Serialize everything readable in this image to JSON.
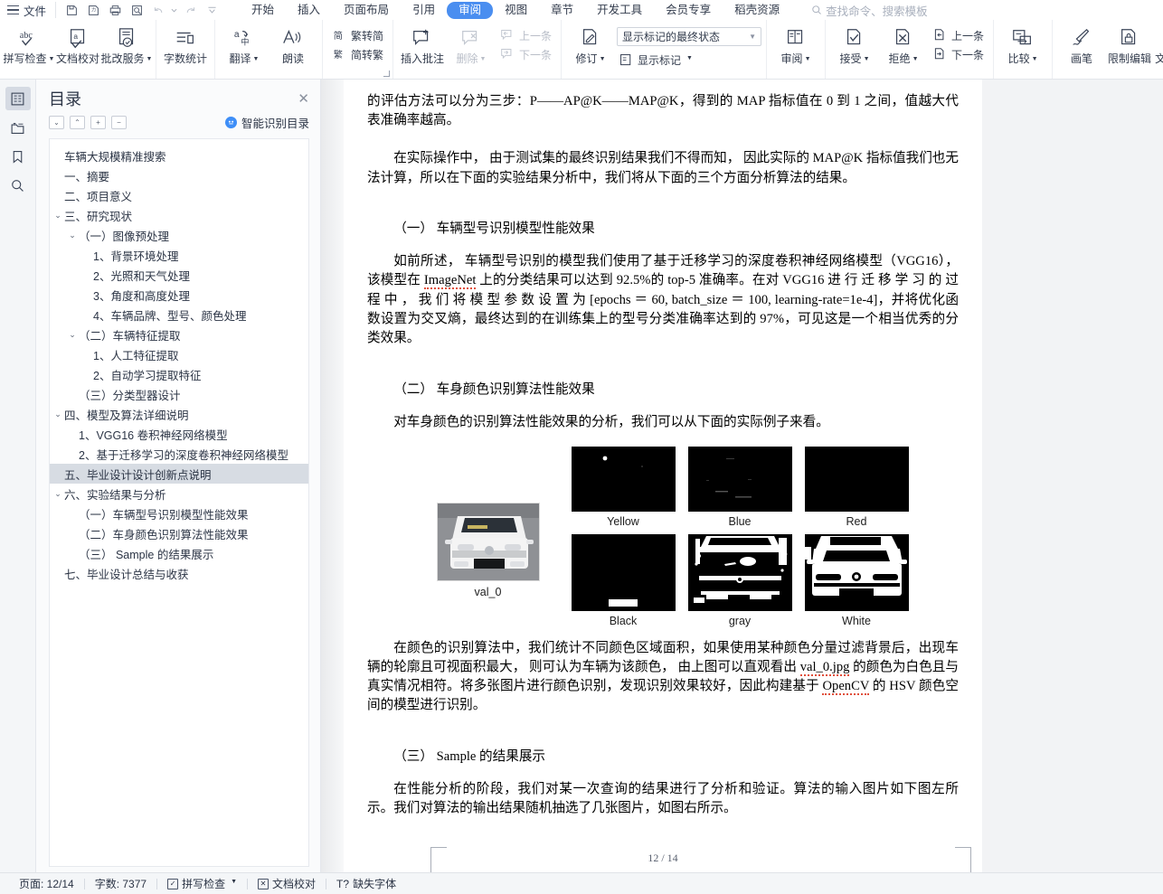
{
  "menubar": {
    "file_label": "文件",
    "quick_access": [
      {
        "name": "save-icon",
        "title": "保存"
      },
      {
        "name": "save-as-icon",
        "title": "另存为"
      },
      {
        "name": "print-icon",
        "title": "打印"
      },
      {
        "name": "print-preview-icon",
        "title": "打印预览"
      },
      {
        "name": "undo-icon",
        "title": "撤销"
      },
      {
        "name": "redo-icon",
        "title": "恢复"
      },
      {
        "name": "customize-icon",
        "title": "自定义快速访问工具栏"
      }
    ],
    "tabs": [
      {
        "label": "开始",
        "active": false
      },
      {
        "label": "插入",
        "active": false
      },
      {
        "label": "页面布局",
        "active": false
      },
      {
        "label": "引用",
        "active": false
      },
      {
        "label": "审阅",
        "active": true
      },
      {
        "label": "视图",
        "active": false
      },
      {
        "label": "章节",
        "active": false
      },
      {
        "label": "开发工具",
        "active": false
      },
      {
        "label": "会员专享",
        "active": false
      },
      {
        "label": "稻壳资源",
        "active": false
      }
    ],
    "search_placeholder": "查找命令、搜索模板"
  },
  "ribbon": {
    "groups": [
      {
        "name": "proofing",
        "items": [
          {
            "label": "拼写检查",
            "icon": "spellcheck-icon",
            "dropdown": true,
            "disabled": false
          },
          {
            "label": "文档校对",
            "icon": "document-proofread-icon",
            "dropdown": false,
            "disabled": false
          },
          {
            "label": "批改服务",
            "icon": "correction-service-icon",
            "dropdown": true,
            "disabled": false
          }
        ]
      },
      {
        "name": "wordcount",
        "items": [
          {
            "label": "字数统计",
            "icon": "word-count-icon",
            "dropdown": false,
            "disabled": false
          }
        ]
      },
      {
        "name": "language",
        "items": [
          {
            "label": "翻译",
            "icon": "translate-icon",
            "dropdown": true,
            "disabled": false
          },
          {
            "label": "朗读",
            "icon": "read-aloud-icon",
            "dropdown": false,
            "disabled": false
          }
        ]
      },
      {
        "name": "chinese-conversion",
        "rows": [
          {
            "label": "繁转简",
            "icon": "trad-to-simp-icon"
          },
          {
            "label": "简转繁",
            "icon": "simp-to-trad-icon"
          }
        ]
      },
      {
        "name": "comments",
        "items": [
          {
            "label": "插入批注",
            "icon": "insert-comment-icon",
            "dropdown": false,
            "disabled": false
          },
          {
            "label": "删除",
            "icon": "delete-comment-icon",
            "dropdown": true,
            "disabled": true
          }
        ],
        "rows": [
          {
            "label": "上一条",
            "icon": "previous-comment-icon",
            "disabled": true
          },
          {
            "label": "下一条",
            "icon": "next-comment-icon",
            "disabled": true
          }
        ]
      },
      {
        "name": "tracking",
        "items": [
          {
            "label": "修订",
            "icon": "track-changes-icon",
            "dropdown": true,
            "disabled": false
          }
        ],
        "combo": {
          "value": "显示标记的最终状态"
        },
        "markup": {
          "label": "显示标记",
          "icon": "show-markup-icon",
          "dropdown": true
        }
      },
      {
        "name": "reviewing-pane",
        "items": [
          {
            "label": "审阅",
            "icon": "reviewing-pane-icon",
            "dropdown": true,
            "disabled": false
          }
        ]
      },
      {
        "name": "changes",
        "items": [
          {
            "label": "接受",
            "icon": "accept-icon",
            "dropdown": true,
            "disabled": false
          },
          {
            "label": "拒绝",
            "icon": "reject-icon",
            "dropdown": true,
            "disabled": false
          }
        ],
        "rows": [
          {
            "label": "上一条",
            "icon": "previous-change-icon",
            "disabled": false
          },
          {
            "label": "下一条",
            "icon": "next-change-icon",
            "disabled": false
          }
        ]
      },
      {
        "name": "compare",
        "items": [
          {
            "label": "比较",
            "icon": "compare-icon",
            "dropdown": true,
            "disabled": false
          }
        ]
      },
      {
        "name": "protect",
        "items": [
          {
            "label": "画笔",
            "icon": "brush-icon",
            "dropdown": false,
            "disabled": false
          },
          {
            "label": "限制编辑",
            "icon": "restrict-edit-icon",
            "dropdown": false,
            "disabled": false
          },
          {
            "label": "文档权限",
            "icon": "document-permission-icon",
            "dropdown": false,
            "disabled": false
          }
        ]
      }
    ]
  },
  "rail": {
    "buttons": [
      {
        "name": "outline-icon",
        "active": true
      },
      {
        "name": "folder-icon",
        "active": false
      },
      {
        "name": "bookmark-icon",
        "active": false
      },
      {
        "name": "search-icon",
        "active": false
      }
    ]
  },
  "toc": {
    "title": "目录",
    "close_label": "✕",
    "tools": [
      "⌄",
      "⌃",
      "+",
      "−"
    ],
    "smart_label": "智能识别目录",
    "items": [
      {
        "label": "车辆大规模精准搜索",
        "indent": 1,
        "chevron": "",
        "selected": false
      },
      {
        "label": "一、摘要",
        "indent": 1,
        "chevron": "",
        "selected": false
      },
      {
        "label": "二、项目意义",
        "indent": 1,
        "chevron": "",
        "selected": false
      },
      {
        "label": "三、研究现状",
        "indent": 1,
        "chevron": "⌄",
        "selected": false
      },
      {
        "label": "（一）图像预处理",
        "indent": 2,
        "chevron": "⌄",
        "selected": false
      },
      {
        "label": "1、背景环境处理",
        "indent": 3,
        "chevron": "",
        "selected": false
      },
      {
        "label": "2、光照和天气处理",
        "indent": 3,
        "chevron": "",
        "selected": false
      },
      {
        "label": "3、角度和高度处理",
        "indent": 3,
        "chevron": "",
        "selected": false
      },
      {
        "label": "4、车辆品牌、型号、颜色处理",
        "indent": 3,
        "chevron": "",
        "selected": false
      },
      {
        "label": "（二）车辆特征提取",
        "indent": 2,
        "chevron": "⌄",
        "selected": false
      },
      {
        "label": "1、人工特征提取",
        "indent": 3,
        "chevron": "",
        "selected": false
      },
      {
        "label": "2、自动学习提取特征",
        "indent": 3,
        "chevron": "",
        "selected": false
      },
      {
        "label": "（三）分类型器设计",
        "indent": 2,
        "chevron": "",
        "selected": false
      },
      {
        "label": "四、模型及算法详细说明",
        "indent": 1,
        "chevron": "⌄",
        "selected": false
      },
      {
        "label": "1、VGG16 卷积神经网络模型",
        "indent": 2,
        "chevron": "",
        "selected": false
      },
      {
        "label": "2、基于迁移学习的深度卷积神经网络模型",
        "indent": 2,
        "chevron": "",
        "selected": false
      },
      {
        "label": "五、毕业设计设计创新点说明",
        "indent": 1,
        "chevron": "",
        "selected": true
      },
      {
        "label": "六、实验结果与分析",
        "indent": 1,
        "chevron": "⌄",
        "selected": false
      },
      {
        "label": "（一）车辆型号识别模型性能效果",
        "indent": 2,
        "chevron": "",
        "selected": false
      },
      {
        "label": "（二）车身颜色识别算法性能效果",
        "indent": 2,
        "chevron": "",
        "selected": false
      },
      {
        "label": "（三） Sample 的结果展示",
        "indent": 2,
        "chevron": "",
        "selected": false
      },
      {
        "label": "七、毕业设计总结与收获",
        "indent": 1,
        "chevron": "",
        "selected": false
      }
    ]
  },
  "document": {
    "para1": "的评估方法可以分为三步：P——AP@K——MAP@K，得到的 MAP 指标值在 0 到 1 之间，值越大代表准确率越高。",
    "para2": "在实际操作中， 由于测试集的最终识别结果我们不得而知， 因此实际的 MAP@K 指标值我们也无法计算，所以在下面的实验结果分析中，我们将从下面的三个方面分析算法的结果。",
    "heading1": "（一） 车辆型号识别模型性能效果",
    "para3_a": "如前所述， 车辆型号识别的模型我们使用了基于迁移学习的深度卷积神经网络模型（VGG16），该模型在 ",
    "para3_link": "ImageNet",
    "para3_b": " 上的分类结果可以达到 92.5%的 top-5 准确率。在对 VGG16 进 行 迁 移 学 习 的 过 程 中 ， 我 们 将 模 型 参 数 设 置 为 [epochs ＝ 60, batch_size ＝ 100, learning-rate=1e-4]，并将优化函数设置为交叉熵，最终达到的在训练集上的型号分类准确率达到的 97%，可见这是一个相当优秀的分类效果。",
    "heading2": "（二） 车身颜色识别算法性能效果",
    "para4": "对车身颜色的识别算法性能效果的分析，我们可以从下面的实际例子来看。",
    "figure": {
      "input_caption": "val_0",
      "masks": [
        {
          "caption": "Yellow"
        },
        {
          "caption": "Blue"
        },
        {
          "caption": "Red"
        },
        {
          "caption": "Black"
        },
        {
          "caption": "gray"
        },
        {
          "caption": "White"
        }
      ]
    },
    "para5_a": "在颜色的识别算法中，我们统计不同颜色区域面积，如果使用某种颜色分量过滤背景后，出现车辆的轮廓且可视面积最大， 则可认为车辆为该颜色， 由上图可以直观看出 ",
    "para5_link": "val_0.jpg",
    "para5_b": " 的颜色为白色且与真实情况相符。将多张图片进行颜色识别，发现识别效果较好，因此构建基于 ",
    "para5_link2": "OpenCV",
    "para5_c": " 的 HSV 颜色空间的模型进行识别。",
    "heading3": "（三） Sample 的结果展示",
    "para6": "在性能分析的阶段，我们对某一次查询的结果进行了分析和验证。算法的输入图片如下图左所示。我们对算法的输出结果随机抽选了几张图片，如图右所示。",
    "page_indicator": "12 / 14"
  },
  "status": {
    "page_label": "页面: 12/14",
    "word_count_label": "字数: 7377",
    "spellcheck_label": "拼写检查",
    "proofread_label": "文档校对",
    "missing_font_label": "缺失字体"
  },
  "colors": {
    "accent": "#4a8ef0",
    "ribbon_bg": "#ffffff",
    "panel_bg": "#fafbfc",
    "canvas_bg": "#f2f3f5",
    "selected_toc": "#d7dce3"
  }
}
